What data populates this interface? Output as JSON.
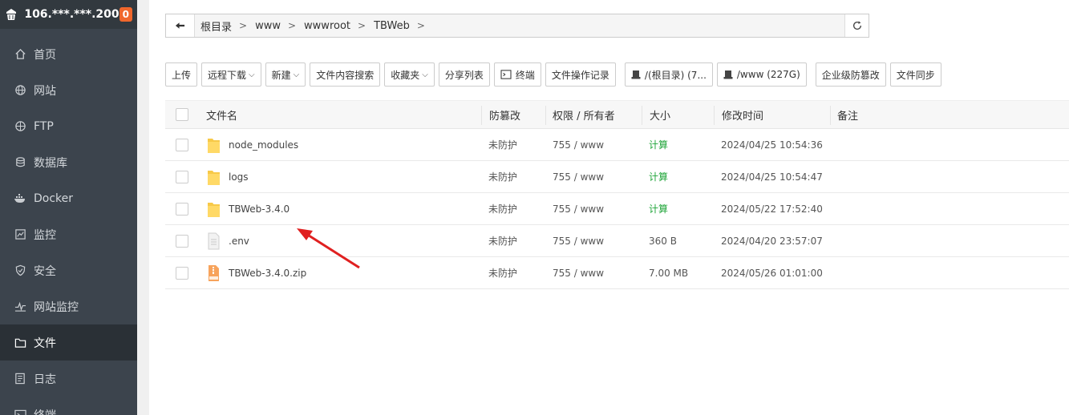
{
  "sidebar": {
    "server_ip": "106.***.***.200",
    "badge": "0",
    "items": [
      {
        "label": "首页",
        "icon": "home-icon",
        "active": false
      },
      {
        "label": "网站",
        "icon": "globe-icon",
        "active": false
      },
      {
        "label": "FTP",
        "icon": "ftp-globe-icon",
        "active": false
      },
      {
        "label": "数据库",
        "icon": "database-icon",
        "active": false
      },
      {
        "label": "Docker",
        "icon": "docker-icon",
        "active": false
      },
      {
        "label": "监控",
        "icon": "monitor-chart-icon",
        "active": false
      },
      {
        "label": "安全",
        "icon": "shield-icon",
        "active": false
      },
      {
        "label": "网站监控",
        "icon": "site-monitor-icon",
        "active": false
      },
      {
        "label": "文件",
        "icon": "folder-icon",
        "active": true
      },
      {
        "label": "日志",
        "icon": "log-icon",
        "active": false
      },
      {
        "label": "终端",
        "icon": "terminal-icon",
        "active": false
      }
    ]
  },
  "path": {
    "crumbs": [
      "根目录",
      "www",
      "wwwroot",
      "TBWeb"
    ]
  },
  "toolbar": {
    "upload": "上传",
    "remote_download": "远程下载",
    "new": "新建",
    "content_search": "文件内容搜索",
    "favorites": "收藏夹",
    "share_list": "分享列表",
    "terminal": "终端",
    "operation_log": "文件操作记录",
    "disk_root": "/(根目录) (7...",
    "disk_www": "/www (227G)",
    "tamper_proof": "企业级防篡改",
    "file_sync": "文件同步"
  },
  "table": {
    "headers": {
      "name": "文件名",
      "protect": "防篡改",
      "perm": "权限 / 所有者",
      "size": "大小",
      "mtime": "修改时间",
      "note": "备注"
    },
    "rows": [
      {
        "name": "node_modules",
        "type": "folder",
        "protect": "未防护",
        "perm": "755 / www",
        "size": "计算",
        "mtime": "2024/04/25 10:54:36"
      },
      {
        "name": "logs",
        "type": "folder",
        "protect": "未防护",
        "perm": "755 / www",
        "size": "计算",
        "mtime": "2024/04/25 10:54:47"
      },
      {
        "name": "TBWeb-3.4.0",
        "type": "folder",
        "protect": "未防护",
        "perm": "755 / www",
        "size": "计算",
        "mtime": "2024/05/22 17:52:40"
      },
      {
        "name": ".env",
        "type": "file",
        "protect": "未防护",
        "perm": "755 / www",
        "size": "360 B",
        "mtime": "2024/04/20 23:57:07"
      },
      {
        "name": "TBWeb-3.4.0.zip",
        "type": "zip",
        "protect": "未防护",
        "perm": "755 / www",
        "size": "7.00 MB",
        "mtime": "2024/05/26 01:01:00"
      }
    ]
  },
  "colors": {
    "sidebar_bg": "#3c444d",
    "accent_green": "#20a53a",
    "badge_orange": "#f0672c",
    "annotation_red": "#e02020"
  }
}
